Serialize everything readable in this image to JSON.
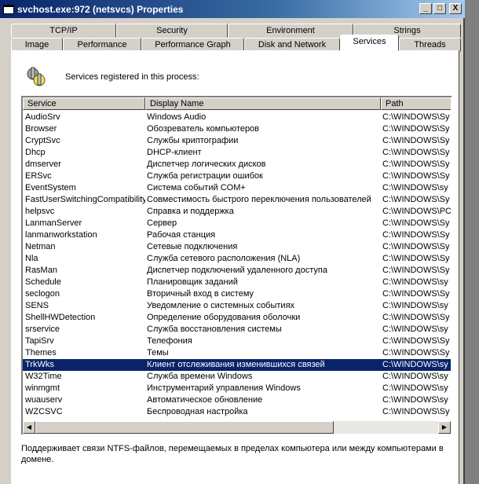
{
  "window": {
    "title": "svchost.exe:972 (netsvcs) Properties",
    "minimize": "_",
    "maximize": "□",
    "close": "X"
  },
  "tabs_row1": [
    "TCP/IP",
    "Security",
    "Environment",
    "Strings"
  ],
  "tabs_row2": [
    "Image",
    "Performance",
    "Performance Graph",
    "Disk and Network",
    "Services",
    "Threads"
  ],
  "active_tab": "Services",
  "intro": "Services registered in this process:",
  "columns": [
    "Service",
    "Display Name",
    "Path"
  ],
  "rows": [
    [
      "AudioSrv",
      "Windows Audio",
      "C:\\WINDOWS\\Sy"
    ],
    [
      "Browser",
      "Обозреватель компьютеров",
      "C:\\WINDOWS\\Sy"
    ],
    [
      "CryptSvc",
      "Службы криптографии",
      "C:\\WINDOWS\\Sy"
    ],
    [
      "Dhcp",
      "DHCP-клиент",
      "C:\\WINDOWS\\Sy"
    ],
    [
      "dmserver",
      "Диспетчер логических дисков",
      "C:\\WINDOWS\\Sy"
    ],
    [
      "ERSvc",
      "Служба регистрации ошибок",
      "C:\\WINDOWS\\Sy"
    ],
    [
      "EventSystem",
      "Система событий COM+",
      "C:\\WINDOWS\\sy"
    ],
    [
      "FastUserSwitchingCompatibility",
      "Совместимость быстрого переключения пользователей",
      "C:\\WINDOWS\\Sy"
    ],
    [
      "helpsvc",
      "Справка и поддержка",
      "C:\\WINDOWS\\PC"
    ],
    [
      "LanmanServer",
      "Сервер",
      "C:\\WINDOWS\\Sy"
    ],
    [
      "lanmanworkstation",
      "Рабочая станция",
      "C:\\WINDOWS\\Sy"
    ],
    [
      "Netman",
      "Сетевые подключения",
      "C:\\WINDOWS\\Sy"
    ],
    [
      "Nla",
      "Служба сетевого расположения (NLA)",
      "C:\\WINDOWS\\Sy"
    ],
    [
      "RasMan",
      "Диспетчер подключений удаленного доступа",
      "C:\\WINDOWS\\Sy"
    ],
    [
      "Schedule",
      "Планировщик заданий",
      "C:\\WINDOWS\\sy"
    ],
    [
      "seclogon",
      "Вторичный вход в систему",
      "C:\\WINDOWS\\Sy"
    ],
    [
      "SENS",
      "Уведомление о системных событиях",
      "C:\\WINDOWS\\sy"
    ],
    [
      "ShellHWDetection",
      "Определение оборудования оболочки",
      "C:\\WINDOWS\\Sy"
    ],
    [
      "srservice",
      "Служба восстановления системы",
      "C:\\WINDOWS\\sy"
    ],
    [
      "TapiSrv",
      "Телефония",
      "C:\\WINDOWS\\Sy"
    ],
    [
      "Themes",
      "Темы",
      "C:\\WINDOWS\\Sy"
    ],
    [
      "TrkWks",
      "Клиент отслеживания изменившихся связей",
      "C:\\WINDOWS\\sy"
    ],
    [
      "W32Time",
      "Служба времени Windows",
      "C:\\WINDOWS\\sy"
    ],
    [
      "winmgmt",
      "Инструментарий управления Windows",
      "C:\\WINDOWS\\sy"
    ],
    [
      "wuauserv",
      "Автоматическое обновление",
      "C:\\WINDOWS\\sy"
    ],
    [
      "WZCSVC",
      "Беспроводная настройка",
      "C:\\WINDOWS\\Sy"
    ]
  ],
  "selected_row": 21,
  "description": "Поддерживает связи NTFS-файлов, перемещаемых в пределах компьютера  или между компьютерами в домене.",
  "colors": {
    "title": "#0a246a",
    "selection": "#0a246a"
  }
}
